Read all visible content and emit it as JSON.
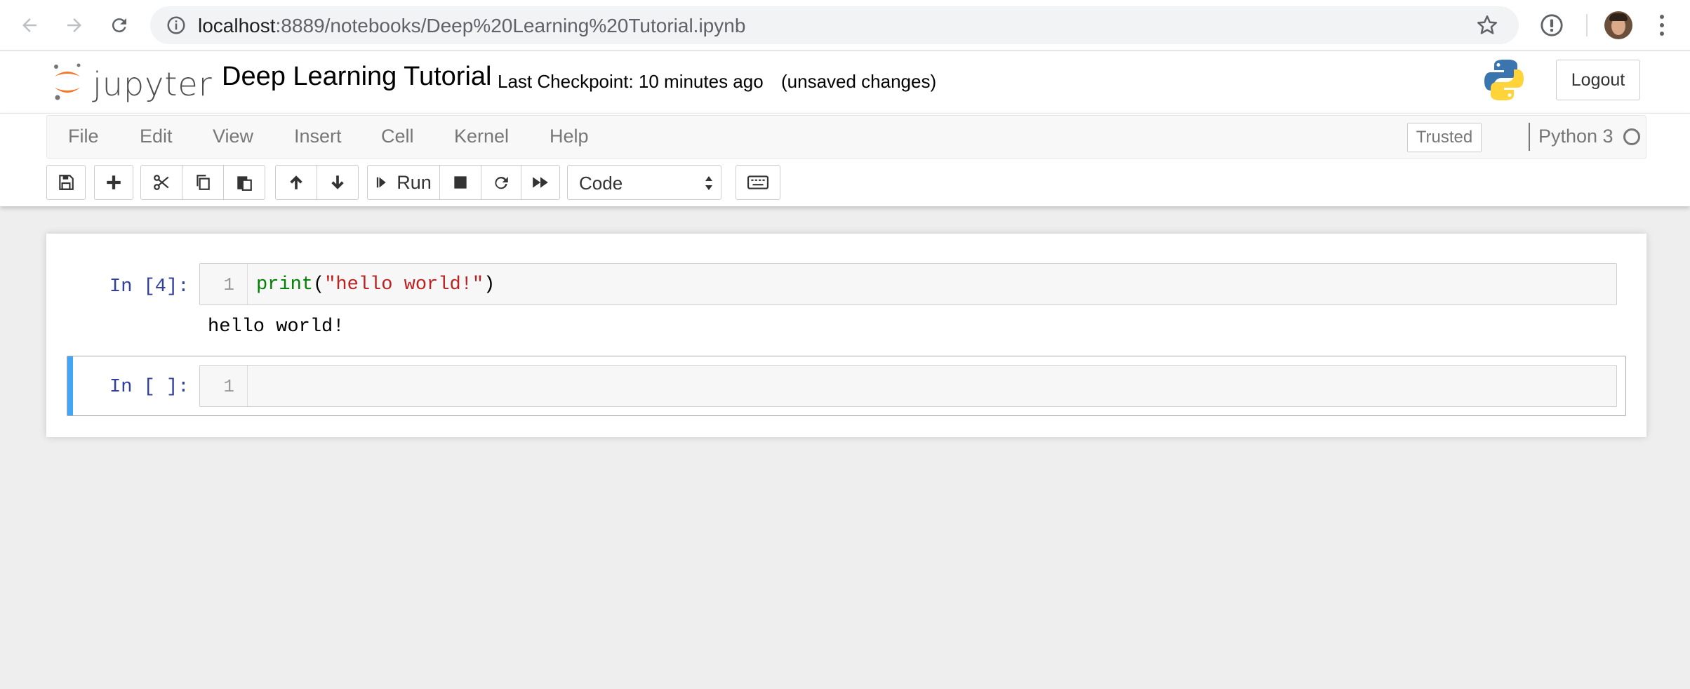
{
  "browser": {
    "url_host": "localhost",
    "url_rest": ":8889/notebooks/Deep%20Learning%20Tutorial.ipynb"
  },
  "header": {
    "logo_text": "jupyter",
    "notebook_title": "Deep Learning Tutorial",
    "checkpoint": "Last Checkpoint: 10 minutes ago",
    "unsaved": "(unsaved changes)",
    "logout_label": "Logout"
  },
  "menu": {
    "items": [
      "File",
      "Edit",
      "View",
      "Insert",
      "Cell",
      "Kernel",
      "Help"
    ],
    "trusted_label": "Trusted",
    "kernel_name": "Python 3"
  },
  "toolbar": {
    "run_label": "Run",
    "cell_type": "Code"
  },
  "cells": [
    {
      "prompt": "In [4]:",
      "line_number": "1",
      "code_fn": "print",
      "code_open": "(",
      "code_string": "\"hello world!\"",
      "code_close": ")",
      "output": "hello world!"
    },
    {
      "prompt": "In [ ]:",
      "line_number": "1"
    }
  ],
  "colors": {
    "prompt_blue": "#303f9f",
    "selected_bar": "#42a5f5",
    "keyword_green": "#008000",
    "string_red": "#ba2121",
    "jupyter_orange": "#f37726"
  },
  "icons": [
    "back-icon",
    "forward-icon",
    "reload-icon",
    "info-icon",
    "star-icon",
    "extension-icon",
    "kebab-menu-icon",
    "save-icon",
    "plus-icon",
    "cut-icon",
    "copy-icon",
    "paste-icon",
    "arrow-up-icon",
    "arrow-down-icon",
    "step-forward-icon",
    "stop-icon",
    "restart-icon",
    "fast-forward-icon",
    "keyboard-icon",
    "python-logo-icon"
  ]
}
